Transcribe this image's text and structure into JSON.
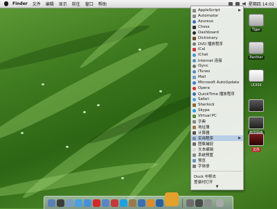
{
  "menubar": {
    "app": "Finder",
    "items": [
      "文件",
      "编辑",
      "显示",
      "前往",
      "窗口",
      "帮助"
    ],
    "clock": "星期四 14:02"
  },
  "dropdown": {
    "items": [
      {
        "label": "AppleScript",
        "submenu": true
      },
      {
        "label": "Automator"
      },
      {
        "label": "Azureus"
      },
      {
        "label": "Chess"
      },
      {
        "label": "Dashboard"
      },
      {
        "label": "Dictionary"
      },
      {
        "label": "DVD 播放程序"
      },
      {
        "label": "iCal"
      },
      {
        "label": "iChat"
      },
      {
        "label": "Internet 连接"
      },
      {
        "label": "iSync"
      },
      {
        "label": "iTunes"
      },
      {
        "label": "Mail"
      },
      {
        "label": "Microsoft AutoUpdate"
      },
      {
        "label": "Opera"
      },
      {
        "label": "QuickTime 播放程序"
      },
      {
        "label": "Safari"
      },
      {
        "label": "Sherlock"
      },
      {
        "label": "Skype"
      },
      {
        "label": "Virtual PC"
      },
      {
        "label": "字典"
      },
      {
        "label": "地址簿"
      },
      {
        "label": "计算器"
      },
      {
        "label": "实用程序",
        "submenu": true
      },
      {
        "label": "图像捕捉"
      },
      {
        "label": "文本编辑"
      },
      {
        "label": "系统预置"
      },
      {
        "label": "预览"
      },
      {
        "label": "字体册"
      }
    ],
    "footer": [
      {
        "label": "Dock 中移去"
      },
      {
        "label": "登录时打开"
      }
    ],
    "scroll_arrow": "▼",
    "submenu_arrow": "▶"
  },
  "desktop_icons": [
    {
      "label": "Tiger"
    },
    {
      "label": "Panther"
    },
    {
      "label": "UDISK"
    },
    {
      "label": ""
    },
    {
      "label": "截屏图像"
    },
    {
      "label": "文件"
    }
  ]
}
